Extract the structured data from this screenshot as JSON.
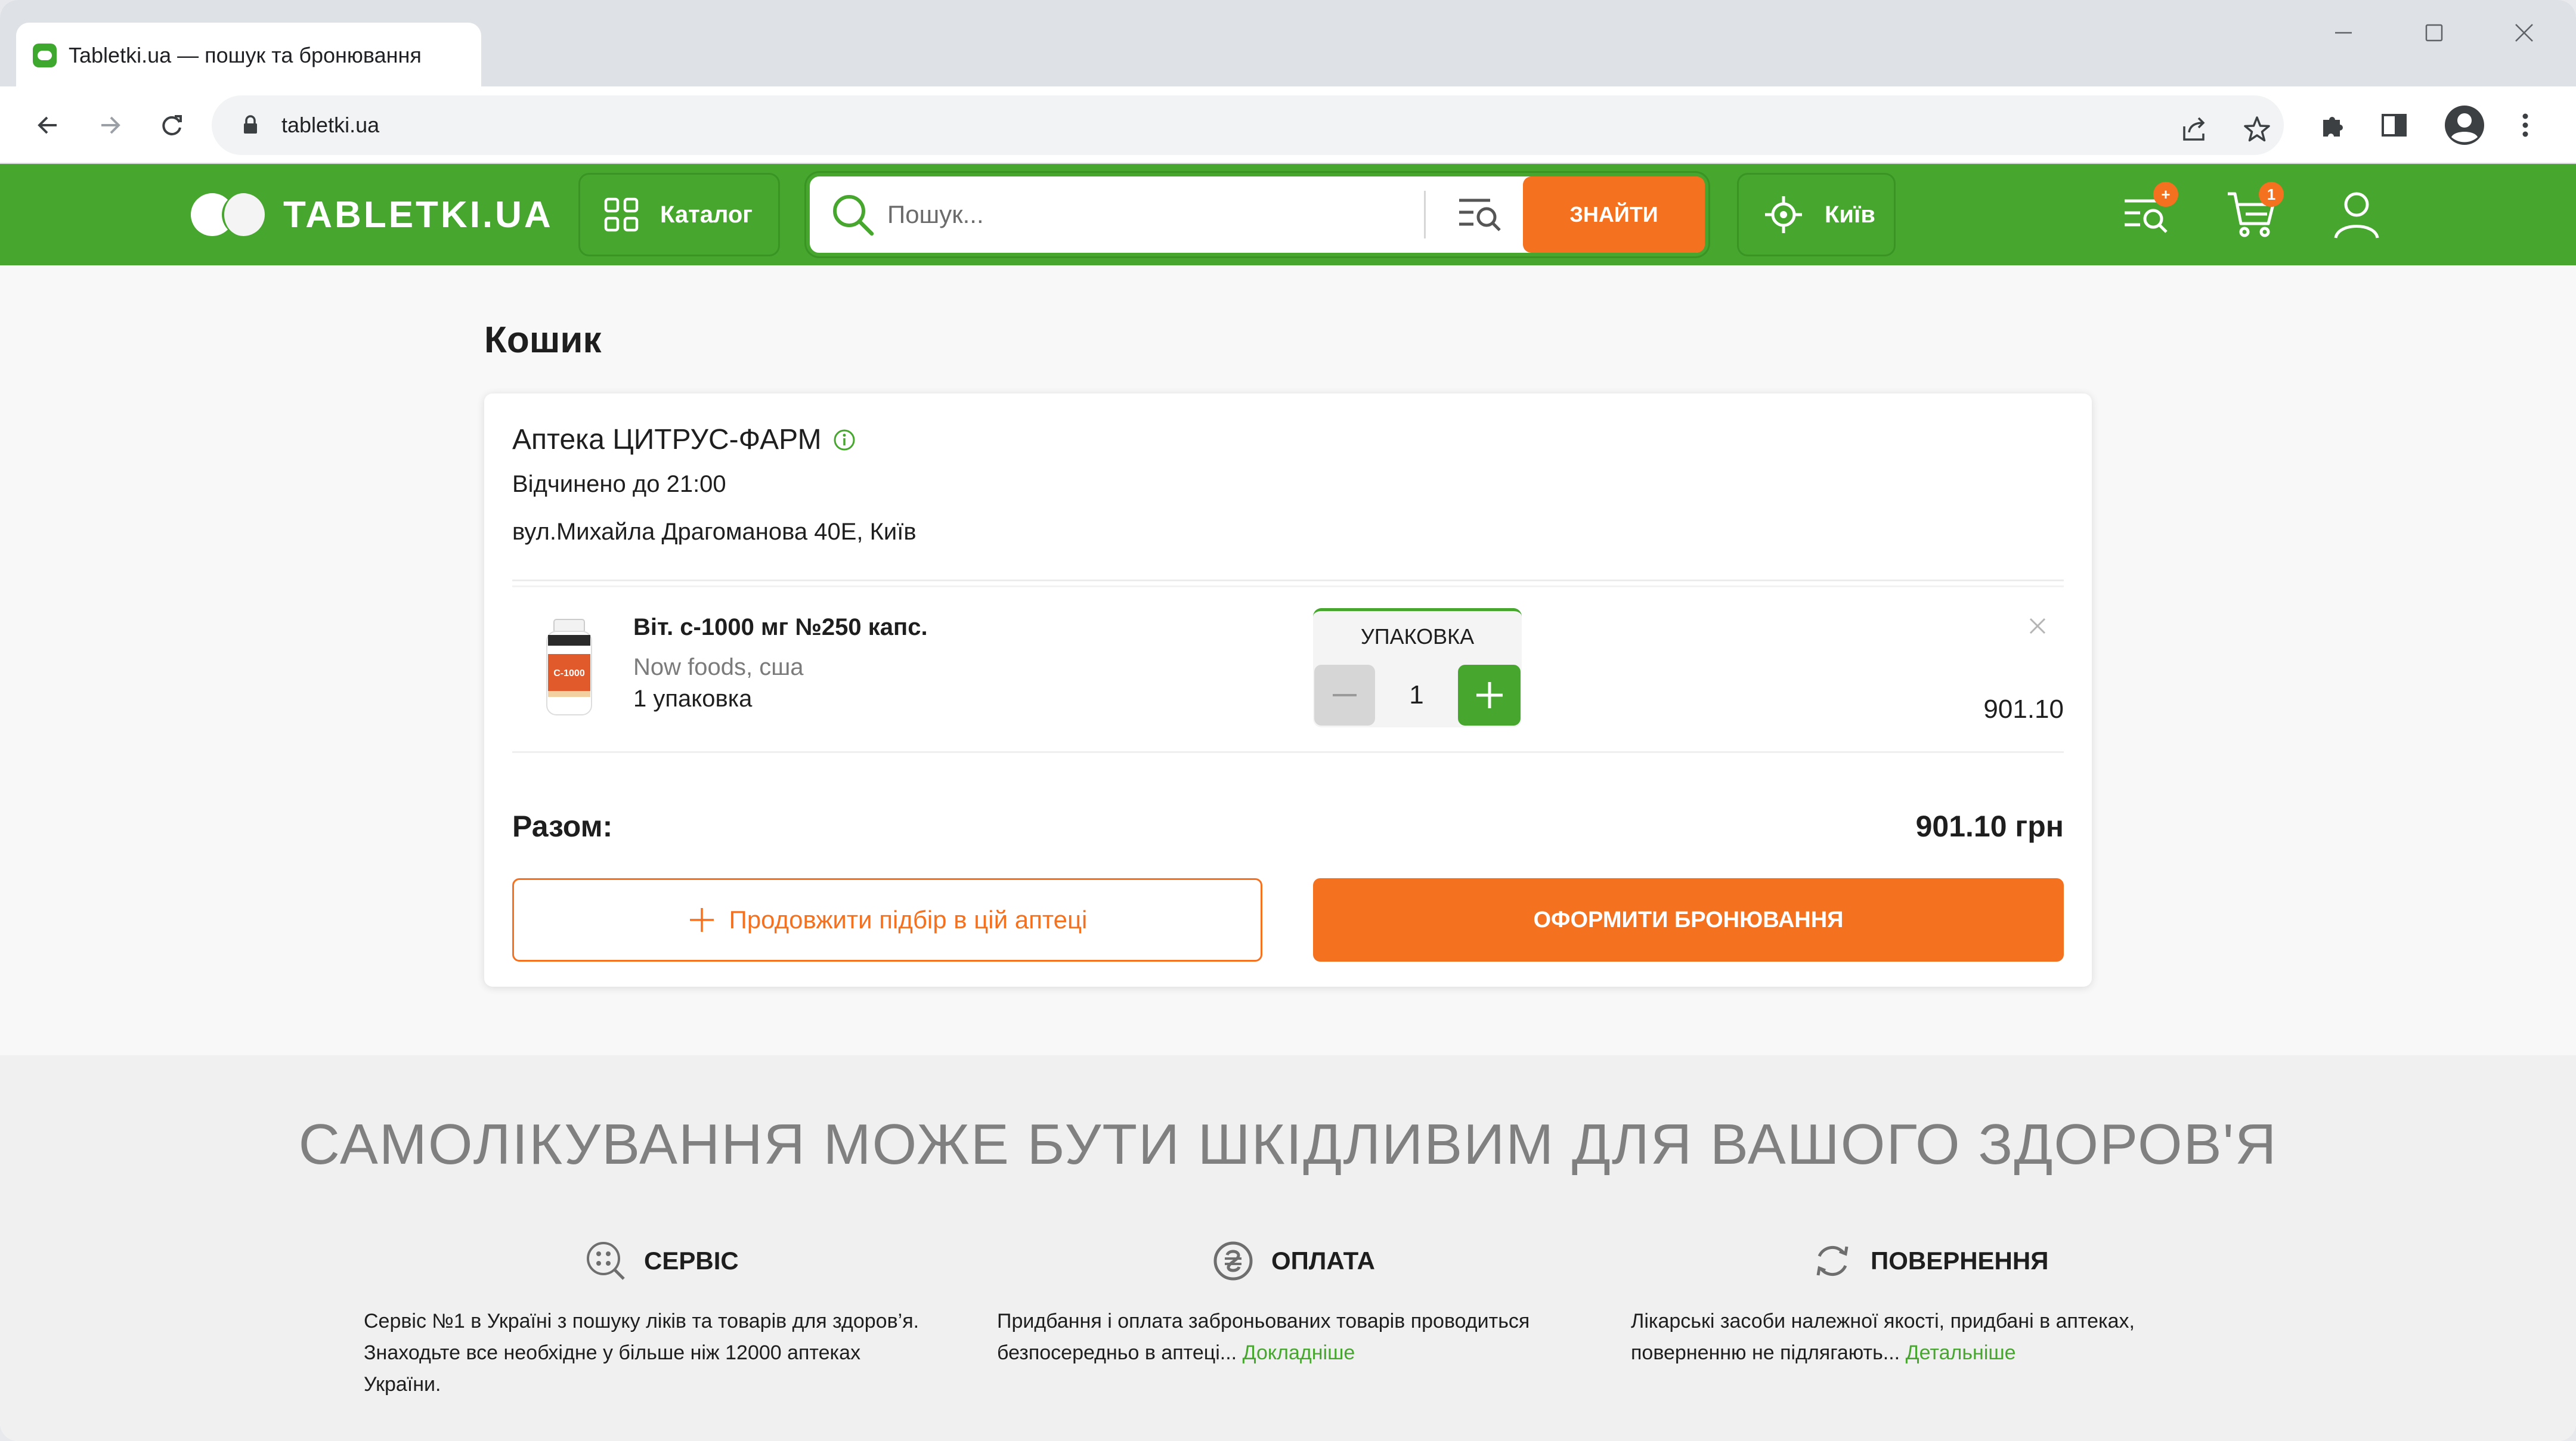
{
  "browser": {
    "tab_title": "Tabletki.ua — пошук та бронювання",
    "url": "tabletki.ua"
  },
  "header": {
    "logo_text": "TABLETKI.UA",
    "catalog_label": "Каталог",
    "search_placeholder": "Пошук...",
    "search_button": "ЗНАЙТИ",
    "city_label": "Київ",
    "compare_badge": "+",
    "cart_badge": "1"
  },
  "cart": {
    "title": "Кошик",
    "pharmacy": {
      "name": "Аптека ЦИТРУС-ФАРМ",
      "hours": "Відчинено до 21:00",
      "address": "вул.Михайла Драгоманова 40Е, Київ"
    },
    "item": {
      "name": "Віт. с-1000 мг №250 капс.",
      "maker": "Now foods, сша",
      "qty_text": "1 упаковка",
      "pack_label": "УПАКОВКА",
      "quantity": "1",
      "price": "901.10",
      "image_label": "C-1000"
    },
    "total_label": "Разом:",
    "total_value": "901.10 грн",
    "continue_label": "Продовжити підбір в цій аптеці",
    "book_label": "ОФОРМИТИ БРОНЮВАННЯ"
  },
  "footer": {
    "warning": "САМОЛІКУВАННЯ МОЖЕ БУТИ ШКІДЛИВИМ ДЛЯ ВАШОГО ЗДОРОВ'Я",
    "columns": [
      {
        "title": "СЕРВІС",
        "icon": "service-icon",
        "text": "Сервіс №1 в Україні з пошуку ліків та товарів для здоров’я.\nЗнаходьте все необхідне у більше ніж 12000 аптеках\nУкраїни."
      },
      {
        "title": "ОПЛАТА",
        "icon": "hryvnia-coin-icon",
        "text": "Придбання і оплата заброньованих товарів проводиться\nбезпосередньо в аптеці... ",
        "link": "Докладніше"
      },
      {
        "title": "ПОВЕРНЕННЯ",
        "icon": "refresh-icon",
        "text": "Лікарські засоби належної якості, придбані в аптеках,\nповерненню не підлягають... ",
        "link": "Детальніше"
      }
    ]
  },
  "colors": {
    "brand_green": "#46a62e",
    "accent_orange": "#f47120"
  }
}
